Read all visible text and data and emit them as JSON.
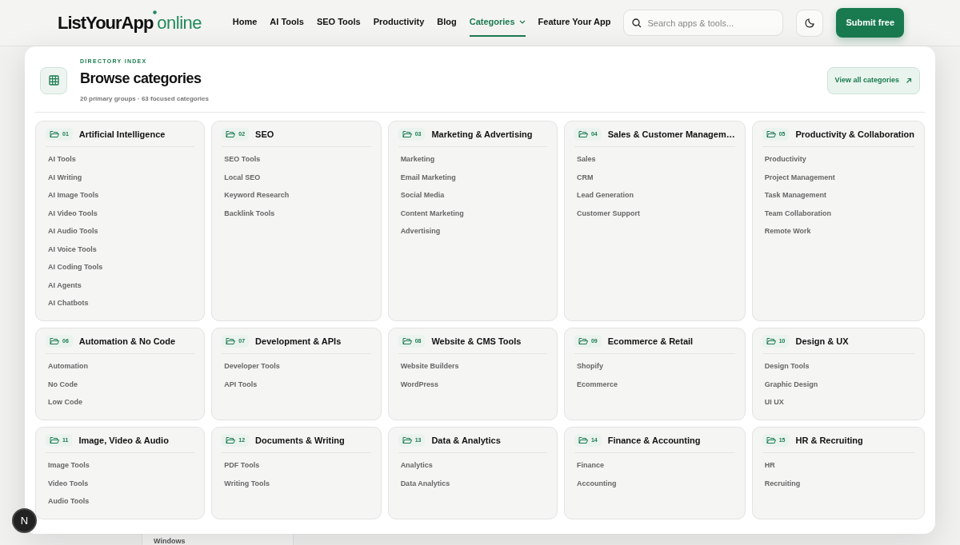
{
  "header": {
    "logo_main": "ListYourApp",
    "logo_suffix": "online",
    "nav": [
      {
        "label": "Home",
        "selected": false,
        "kind": "link"
      },
      {
        "label": "AI Tools",
        "selected": false,
        "kind": "link"
      },
      {
        "label": "SEO Tools",
        "selected": false,
        "kind": "link"
      },
      {
        "label": "Productivity",
        "selected": false,
        "kind": "link"
      },
      {
        "label": "Blog",
        "selected": false,
        "kind": "link"
      },
      {
        "label": "Categories",
        "selected": true,
        "kind": "dropdown"
      },
      {
        "label": "Feature Your App",
        "selected": false,
        "kind": "link"
      }
    ],
    "search": {
      "placeholder": "Search apps & tools..."
    },
    "submit_button": "Submit free"
  },
  "menu": {
    "eyebrow": "DIRECTORY INDEX",
    "title": "Browse categories",
    "subtitle": "20 primary groups · 63 focused categories",
    "view_all": "View all categories",
    "groups": [
      {
        "number": "01",
        "title": "Artificial Intelligence",
        "items": [
          "AI Tools",
          "AI Writing",
          "AI Image Tools",
          "AI Video Tools",
          "AI Audio Tools",
          "AI Voice Tools",
          "AI Coding Tools",
          "AI Agents",
          "AI Chatbots"
        ]
      },
      {
        "number": "02",
        "title": "SEO",
        "items": [
          "SEO Tools",
          "Local SEO",
          "Keyword Research",
          "Backlink Tools"
        ]
      },
      {
        "number": "03",
        "title": "Marketing & Advertising",
        "items": [
          "Marketing",
          "Email Marketing",
          "Social Media",
          "Content Marketing",
          "Advertising"
        ]
      },
      {
        "number": "04",
        "title": "Sales & Customer Managem…",
        "items": [
          "Sales",
          "CRM",
          "Lead Generation",
          "Customer Support"
        ]
      },
      {
        "number": "05",
        "title": "Productivity & Collaboration",
        "items": [
          "Productivity",
          "Project Management",
          "Task Management",
          "Team Collaboration",
          "Remote Work"
        ]
      },
      {
        "number": "06",
        "title": "Automation & No Code",
        "items": [
          "Automation",
          "No Code",
          "Low Code"
        ]
      },
      {
        "number": "07",
        "title": "Development & APIs",
        "items": [
          "Developer Tools",
          "API Tools"
        ]
      },
      {
        "number": "08",
        "title": "Website & CMS Tools",
        "items": [
          "Website Builders",
          "WordPress"
        ]
      },
      {
        "number": "09",
        "title": "Ecommerce & Retail",
        "items": [
          "Shopify",
          "Ecommerce"
        ]
      },
      {
        "number": "10",
        "title": "Design & UX",
        "items": [
          "Design Tools",
          "Graphic Design",
          "UI UX"
        ]
      },
      {
        "number": "11",
        "title": "Image, Video & Audio",
        "items": [
          "Image Tools",
          "Video Tools",
          "Audio Tools"
        ]
      },
      {
        "number": "12",
        "title": "Documents & Writing",
        "items": [
          "PDF Tools",
          "Writing Tools"
        ]
      },
      {
        "number": "13",
        "title": "Data & Analytics",
        "items": [
          "Analytics",
          "Data Analytics"
        ]
      },
      {
        "number": "14",
        "title": "Finance & Accounting",
        "items": [
          "Finance",
          "Accounting"
        ]
      },
      {
        "number": "15",
        "title": "HR & Recruiting",
        "items": [
          "HR",
          "Recruiting"
        ]
      }
    ]
  },
  "background": {
    "list_item": "Windows"
  },
  "floating_button": "N"
}
